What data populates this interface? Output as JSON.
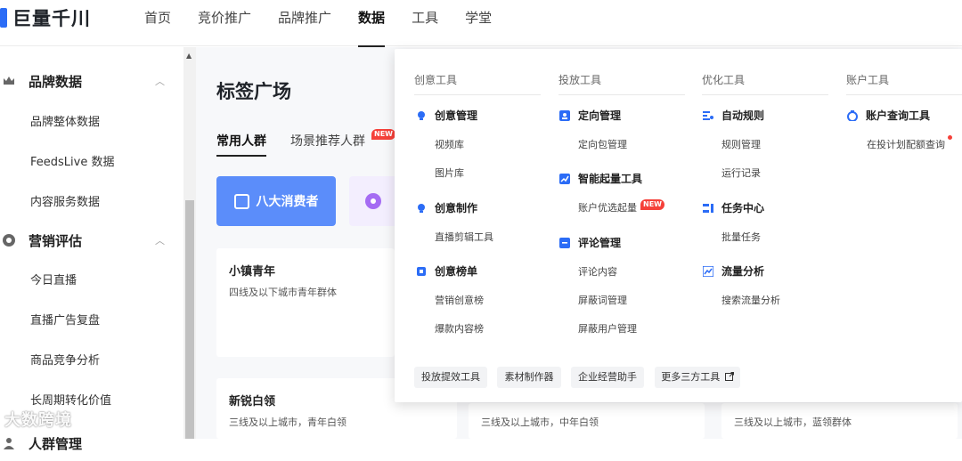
{
  "brand": {
    "name": "巨量千川"
  },
  "nav": {
    "items": [
      "首页",
      "竞价推广",
      "品牌推广",
      "数据",
      "工具",
      "学堂"
    ],
    "active_index": 3
  },
  "sidebar": {
    "groups": [
      {
        "label": "品牌数据",
        "icon": "crown-icon",
        "items": [
          "品牌整体数据",
          "FeedsLive 数据",
          "内容服务数据"
        ]
      },
      {
        "label": "营销评估",
        "icon": "target-icon",
        "items": [
          "今日直播",
          "直播广告复盘",
          "商品竞争分析",
          "长周期转化价值"
        ]
      },
      {
        "label": "人群管理",
        "icon": "people-icon",
        "items": []
      }
    ]
  },
  "main": {
    "title": "标签广场",
    "tabs": [
      "常用人群",
      "场景推荐人群"
    ],
    "new_badge": "NEW",
    "pill_primary": "八大消费者",
    "cards": [
      {
        "title": "小镇青年",
        "desc": "四线及以下城市青年群体"
      },
      {
        "title": "新锐白领",
        "desc": "三线及以上城市，青年白领"
      },
      {
        "title": "",
        "desc": "三线及以上城市，中年白领"
      },
      {
        "title": "",
        "desc": "三线及以上城市，蓝领群体"
      }
    ]
  },
  "dropdown": {
    "columns": [
      {
        "heading": "创意工具",
        "sections": [
          {
            "title": "创意管理",
            "icon": "bulb-icon",
            "links": [
              "视频库",
              "图片库"
            ]
          },
          {
            "title": "创意制作",
            "icon": "bulb-icon",
            "links": [
              "直播剪辑工具"
            ]
          },
          {
            "title": "创意榜单",
            "icon": "trophy-icon",
            "links": [
              "营销创意榜",
              "爆款内容榜"
            ]
          }
        ]
      },
      {
        "heading": "投放工具",
        "sections": [
          {
            "title": "定向管理",
            "icon": "person-card-icon",
            "links": [
              "定向包管理"
            ]
          },
          {
            "title": "智能起量工具",
            "icon": "trend-icon",
            "links": [
              "账户优选起量"
            ]
          },
          {
            "title": "评论管理",
            "icon": "comment-icon",
            "links": [
              "评论内容",
              "屏蔽词管理",
              "屏蔽用户管理"
            ]
          }
        ]
      },
      {
        "heading": "优化工具",
        "sections": [
          {
            "title": "自动规则",
            "icon": "rule-icon",
            "links": [
              "规则管理",
              "运行记录"
            ]
          },
          {
            "title": "任务中心",
            "icon": "task-icon",
            "links": [
              "批量任务"
            ]
          },
          {
            "title": "流量分析",
            "icon": "chart-icon",
            "links": [
              "搜索流量分析"
            ]
          }
        ]
      },
      {
        "heading": "账户工具",
        "sections": [
          {
            "title": "账户查询工具",
            "icon": "clock-icon",
            "links": [
              "在投计划配额查询"
            ]
          }
        ]
      }
    ],
    "footer_buttons": [
      "投放提效工具",
      "素材制作器",
      "企业经营助手",
      "更多三方工具"
    ],
    "accent": "#2b6cf6",
    "badge_color": "#f5413a"
  },
  "watermark": "大数跨境"
}
